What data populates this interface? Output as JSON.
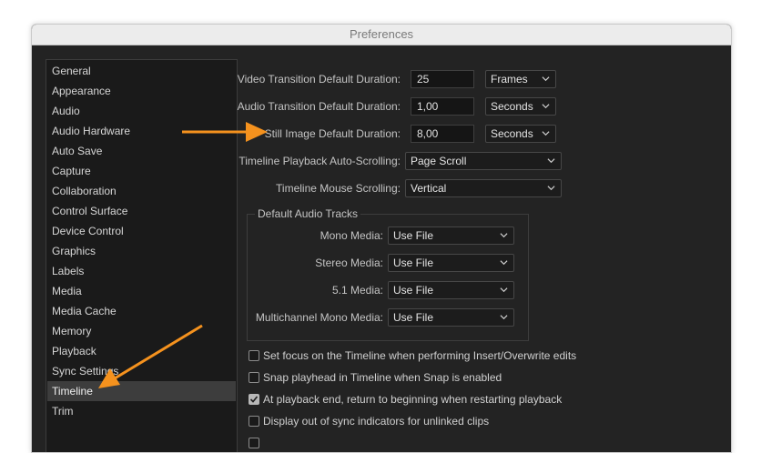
{
  "window": {
    "title": "Preferences"
  },
  "sidebar": {
    "items": [
      {
        "label": "General"
      },
      {
        "label": "Appearance"
      },
      {
        "label": "Audio"
      },
      {
        "label": "Audio Hardware"
      },
      {
        "label": "Auto Save"
      },
      {
        "label": "Capture"
      },
      {
        "label": "Collaboration"
      },
      {
        "label": "Control Surface"
      },
      {
        "label": "Device Control"
      },
      {
        "label": "Graphics"
      },
      {
        "label": "Labels"
      },
      {
        "label": "Media"
      },
      {
        "label": "Media Cache"
      },
      {
        "label": "Memory"
      },
      {
        "label": "Playback"
      },
      {
        "label": "Sync Settings"
      },
      {
        "label": "Timeline",
        "selected": true
      },
      {
        "label": "Trim"
      }
    ],
    "selected": "Timeline"
  },
  "timeline": {
    "video_transition": {
      "label": "Video Transition Default Duration:",
      "value": "25",
      "unit": "Frames"
    },
    "audio_transition": {
      "label": "Audio Transition Default Duration:",
      "value": "1,00",
      "unit": "Seconds"
    },
    "still_image": {
      "label": "Still Image Default Duration:",
      "value": "8,00",
      "unit": "Seconds"
    },
    "auto_scrolling": {
      "label": "Timeline Playback Auto-Scrolling:",
      "value": "Page Scroll"
    },
    "mouse_scrolling": {
      "label": "Timeline Mouse Scrolling:",
      "value": "Vertical"
    },
    "default_audio_tracks": {
      "title": "Default Audio Tracks",
      "mono": {
        "label": "Mono Media:",
        "value": "Use File"
      },
      "stereo": {
        "label": "Stereo Media:",
        "value": "Use File"
      },
      "five_one": {
        "label": "5.1 Media:",
        "value": "Use File"
      },
      "multichannel": {
        "label": "Multichannel Mono Media:",
        "value": "Use File"
      }
    },
    "checkboxes": [
      {
        "label": "Set focus on the Timeline when performing Insert/Overwrite edits",
        "checked": false
      },
      {
        "label": "Snap playhead in Timeline when Snap is enabled",
        "checked": false
      },
      {
        "label": "At playback end, return to beginning when restarting playback",
        "checked": true
      },
      {
        "label": "Display out of sync indicators for unlinked clips",
        "checked": false
      }
    ]
  },
  "colors": {
    "annotation_arrow": "#F5921E",
    "window_bg": "#232323",
    "sidebar_bg": "#1a1a1a",
    "selected_bg": "#3d3d3d"
  },
  "icons": {
    "dropdown": "chevron-down-icon",
    "check": "checkmark-icon"
  }
}
